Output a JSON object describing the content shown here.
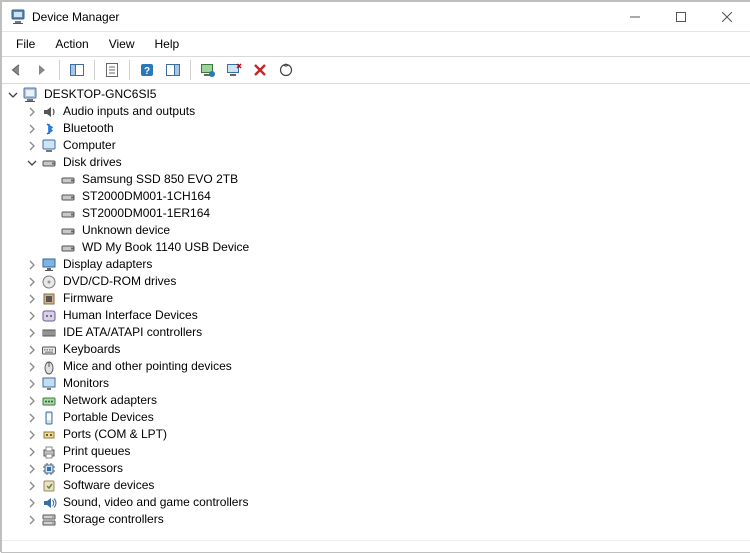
{
  "window": {
    "title": "Device Manager"
  },
  "menu": {
    "file": "File",
    "action": "Action",
    "view": "View",
    "help": "Help"
  },
  "toolbar": {
    "back": "back",
    "forward": "forward",
    "show_hide_tree": "show-hide-console-tree",
    "properties": "properties",
    "help": "help",
    "show_hide_action": "show-hide-action-pane",
    "update_driver": "update-driver",
    "uninstall": "uninstall-device",
    "disable": "disable-device",
    "scan": "scan-for-hardware-changes"
  },
  "tree": {
    "root": {
      "label": "DESKTOP-GNC6SI5",
      "icon": "computer-icon",
      "expanded": true
    },
    "categories": [
      {
        "label": "Audio inputs and outputs",
        "icon": "audio-icon",
        "expanded": false,
        "children": []
      },
      {
        "label": "Bluetooth",
        "icon": "bluetooth-icon",
        "expanded": false,
        "children": []
      },
      {
        "label": "Computer",
        "icon": "desktop-icon",
        "expanded": false,
        "children": []
      },
      {
        "label": "Disk drives",
        "icon": "disk-icon",
        "expanded": true,
        "children": [
          {
            "label": "Samsung SSD 850 EVO 2TB",
            "icon": "disk-icon"
          },
          {
            "label": "ST2000DM001-1CH164",
            "icon": "disk-icon"
          },
          {
            "label": "ST2000DM001-1ER164",
            "icon": "disk-icon"
          },
          {
            "label": "Unknown device",
            "icon": "disk-icon"
          },
          {
            "label": "WD My Book 1140 USB Device",
            "icon": "disk-icon"
          }
        ]
      },
      {
        "label": "Display adapters",
        "icon": "display-icon",
        "expanded": false,
        "children": []
      },
      {
        "label": "DVD/CD-ROM drives",
        "icon": "optical-icon",
        "expanded": false,
        "children": []
      },
      {
        "label": "Firmware",
        "icon": "firmware-icon",
        "expanded": false,
        "children": []
      },
      {
        "label": "Human Interface Devices",
        "icon": "hid-icon",
        "expanded": false,
        "children": []
      },
      {
        "label": "IDE ATA/ATAPI controllers",
        "icon": "ide-icon",
        "expanded": false,
        "children": []
      },
      {
        "label": "Keyboards",
        "icon": "keyboard-icon",
        "expanded": false,
        "children": []
      },
      {
        "label": "Mice and other pointing devices",
        "icon": "mouse-icon",
        "expanded": false,
        "children": []
      },
      {
        "label": "Monitors",
        "icon": "monitor-icon",
        "expanded": false,
        "children": []
      },
      {
        "label": "Network adapters",
        "icon": "network-icon",
        "expanded": false,
        "children": []
      },
      {
        "label": "Portable Devices",
        "icon": "portable-icon",
        "expanded": false,
        "children": []
      },
      {
        "label": "Ports (COM & LPT)",
        "icon": "port-icon",
        "expanded": false,
        "children": []
      },
      {
        "label": "Print queues",
        "icon": "printer-icon",
        "expanded": false,
        "children": []
      },
      {
        "label": "Processors",
        "icon": "cpu-icon",
        "expanded": false,
        "children": []
      },
      {
        "label": "Software devices",
        "icon": "software-icon",
        "expanded": false,
        "children": []
      },
      {
        "label": "Sound, video and game controllers",
        "icon": "sound-icon",
        "expanded": false,
        "children": []
      },
      {
        "label": "Storage controllers",
        "icon": "storage-icon",
        "expanded": false,
        "children": []
      }
    ]
  }
}
